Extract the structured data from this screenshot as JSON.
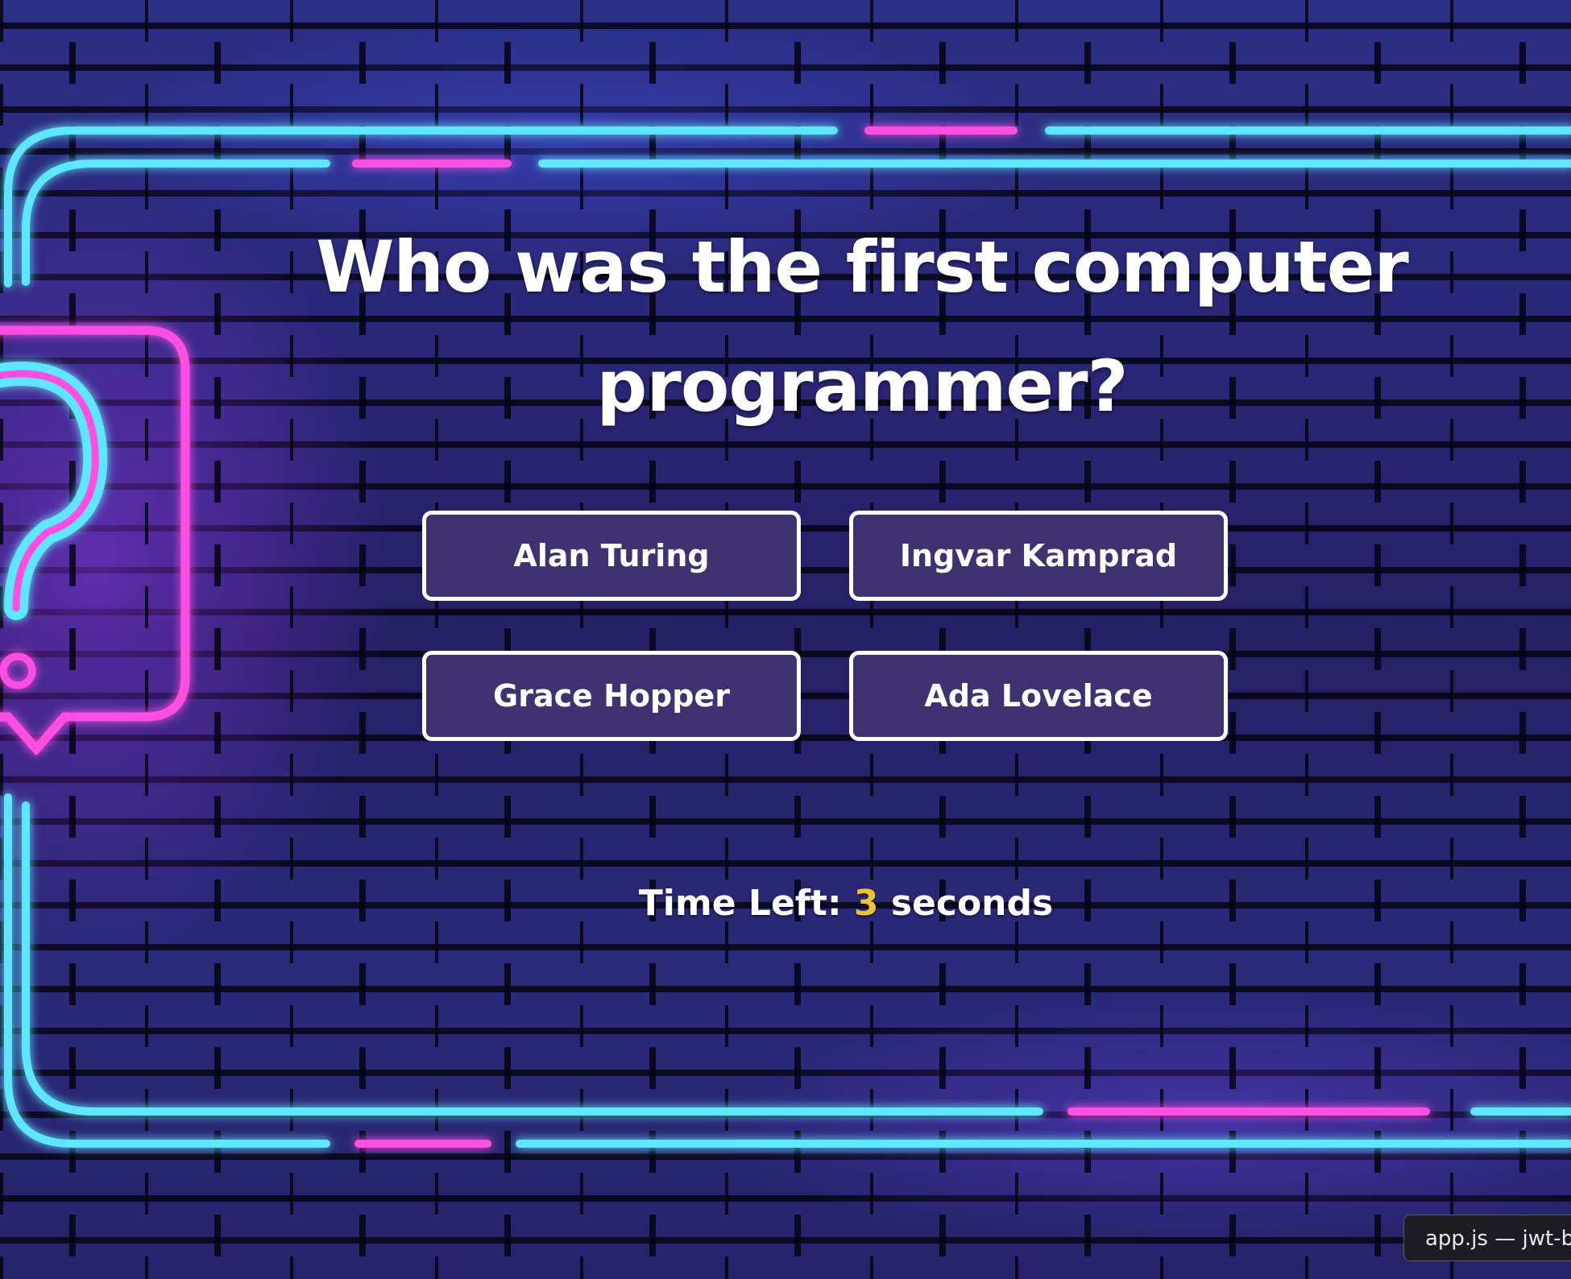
{
  "question": {
    "text": "Who was the first computer programmer?"
  },
  "answers": [
    {
      "label": "Alan Turing"
    },
    {
      "label": "Ingvar Kamprad"
    },
    {
      "label": "Grace Hopper"
    },
    {
      "label": "Ada Lovelace"
    }
  ],
  "timer": {
    "prefix": "Time Left:",
    "value": "3",
    "suffix": "seconds"
  },
  "tooltip": {
    "text": "app.js — jwt-b"
  },
  "colors": {
    "button_bg": "#3e3270",
    "button_border": "#ffffff",
    "timer_number": "#f1c232",
    "neon_cyan": "#5fe6ff",
    "neon_pink": "#ff4fe3"
  },
  "icons": [
    "question-mark-speech-bubble-icon"
  ]
}
